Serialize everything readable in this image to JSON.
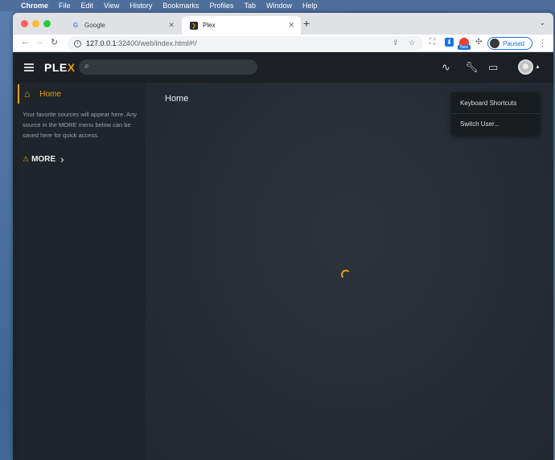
{
  "menubar": {
    "items": [
      "Chrome",
      "File",
      "Edit",
      "View",
      "History",
      "Bookmarks",
      "Profiles",
      "Tab",
      "Window",
      "Help"
    ]
  },
  "browser": {
    "tabs": [
      {
        "title": "Google",
        "favicon": "google-icon",
        "active": false
      },
      {
        "title": "Plex",
        "favicon": "plex-icon",
        "active": true
      }
    ],
    "address": {
      "host": "127.0.0.1",
      "path": ":32400/web/index.html#!/"
    },
    "profile_status": "Paused",
    "new_badge": "New"
  },
  "plex": {
    "logo_main": "PLE",
    "logo_x": "X",
    "sidebar": {
      "home_label": "Home",
      "note": "Your favorite sources will appear here. Any source in the MORE menu below can be saved here for quick access.",
      "more_label": "MORE"
    },
    "main": {
      "title": "Home"
    },
    "user_menu": {
      "items": [
        "Keyboard Shortcuts",
        "Switch User..."
      ]
    }
  },
  "colors": {
    "accent": "#e5a00d",
    "background": "#1f2326"
  }
}
